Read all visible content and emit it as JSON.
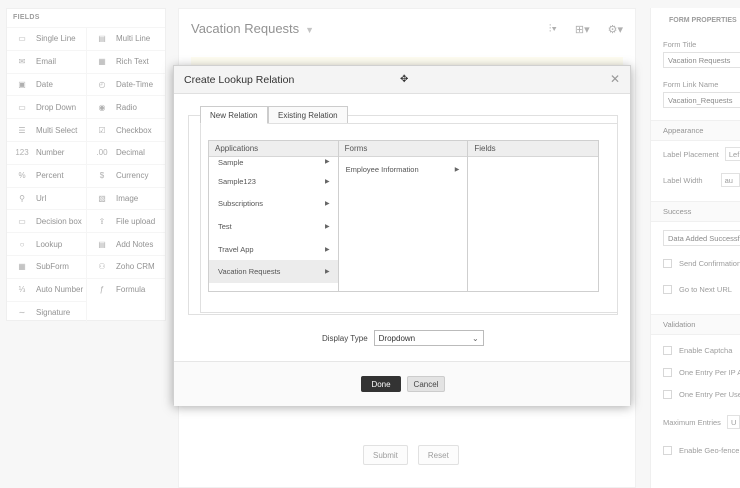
{
  "fields_panel": {
    "header": "FIELDS",
    "items": [
      {
        "label": "Single Line",
        "icon": "single-line-icon",
        "glyph": "▭"
      },
      {
        "label": "Multi Line",
        "icon": "multi-line-icon",
        "glyph": "▤"
      },
      {
        "label": "Email",
        "icon": "email-icon",
        "glyph": "✉"
      },
      {
        "label": "Rich Text",
        "icon": "rich-text-icon",
        "glyph": "▦"
      },
      {
        "label": "Date",
        "icon": "date-icon",
        "glyph": "▣"
      },
      {
        "label": "Date-Time",
        "icon": "date-time-icon",
        "glyph": "◴"
      },
      {
        "label": "Drop Down",
        "icon": "drop-down-icon",
        "glyph": "▭"
      },
      {
        "label": "Radio",
        "icon": "radio-icon",
        "glyph": "◉"
      },
      {
        "label": "Multi Select",
        "icon": "multi-select-icon",
        "glyph": "☰"
      },
      {
        "label": "Checkbox",
        "icon": "checkbox-icon",
        "glyph": "☑"
      },
      {
        "label": "Number",
        "icon": "number-icon",
        "glyph": "123"
      },
      {
        "label": "Decimal",
        "icon": "decimal-icon",
        "glyph": ".00"
      },
      {
        "label": "Percent",
        "icon": "percent-icon",
        "glyph": "%"
      },
      {
        "label": "Currency",
        "icon": "currency-icon",
        "glyph": "$"
      },
      {
        "label": "Url",
        "icon": "url-icon",
        "glyph": "⚲"
      },
      {
        "label": "Image",
        "icon": "image-icon",
        "glyph": "▧"
      },
      {
        "label": "Decision box",
        "icon": "decision-box-icon",
        "glyph": "▭"
      },
      {
        "label": "File upload",
        "icon": "file-upload-icon",
        "glyph": "⇪"
      },
      {
        "label": "Lookup",
        "icon": "lookup-icon",
        "glyph": "○"
      },
      {
        "label": "Add Notes",
        "icon": "add-notes-icon",
        "glyph": "▤"
      },
      {
        "label": "SubForm",
        "icon": "subform-icon",
        "glyph": "▦"
      },
      {
        "label": "Zoho CRM",
        "icon": "zoho-crm-icon",
        "glyph": "⚇"
      },
      {
        "label": "Auto Number",
        "icon": "auto-number-icon",
        "glyph": "⅓"
      },
      {
        "label": "Formula",
        "icon": "formula-icon",
        "glyph": "ƒ"
      },
      {
        "label": "Signature",
        "icon": "signature-icon",
        "glyph": "∼"
      }
    ]
  },
  "builder": {
    "title": "Vacation Requests",
    "submit_label": "Submit",
    "reset_label": "Reset"
  },
  "properties": {
    "header": "FORM PROPERTIES",
    "form_title_label": "Form Title",
    "form_title_value": "Vacation Requests",
    "form_link_label": "Form Link Name",
    "form_link_value": "Vacation_Requests",
    "appearance": "Appearance",
    "label_placement": "Label Placement",
    "label_placement_value": "Lef",
    "label_width": "Label Width",
    "label_width_value": "au",
    "success": "Success",
    "success_value": "Data Added Successfu",
    "send_confirmation": "Send Confirmation",
    "go_to_next_url": "Go to Next URL",
    "validation": "Validation",
    "enable_captcha": "Enable Captcha",
    "one_entry_ip": "One Entry Per IP A",
    "one_entry_user": "One Entry Per Use",
    "maximum_entries": "Maximum Entries",
    "maximum_entries_value": "U",
    "enable_geofence": "Enable Geo-fence I"
  },
  "modal": {
    "title": "Create Lookup Relation",
    "tab_new": "New Relation",
    "tab_existing": "Existing Relation",
    "col_applications": "Applications",
    "col_forms": "Forms",
    "col_fields": "Fields",
    "applications": [
      "Sample",
      "Sample123",
      "Subscriptions",
      "Test",
      "Travel App",
      "Vacation Requests"
    ],
    "selected_application": "Vacation Requests",
    "forms": [
      "Employee Information"
    ],
    "display_type_label": "Display Type",
    "display_type_value": "Dropdown",
    "done_label": "Done",
    "cancel_label": "Cancel"
  }
}
